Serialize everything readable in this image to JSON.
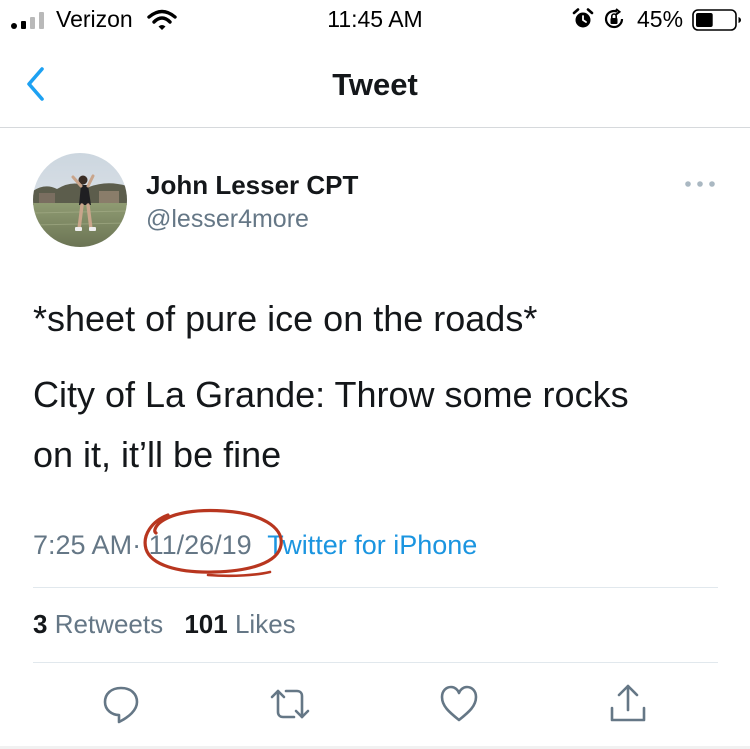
{
  "status_bar": {
    "carrier": "Verizon",
    "time": "11:45 AM",
    "battery_percent": "45%",
    "battery_level": 0.45,
    "icons": [
      "signal-icon",
      "wifi-icon",
      "alarm-icon",
      "orientation-lock-icon",
      "battery-icon"
    ]
  },
  "nav": {
    "back_icon": "chevron-left-icon",
    "title": "Tweet"
  },
  "tweet": {
    "author": {
      "display_name": "John Lesser CPT",
      "handle": "@lesser4more"
    },
    "text_lines": [
      "*sheet of pure ice on the roads*",
      "City of La Grande: Throw some rocks",
      "on it, it’ll be fine"
    ],
    "time": "7:25 AM",
    "separator": "·",
    "date": "11/26/19",
    "source": "Twitter for iPhone",
    "stats": {
      "retweets_count": "3",
      "retweets_label": "Retweets",
      "likes_count": "101",
      "likes_label": "Likes"
    },
    "actions": [
      "reply-icon",
      "retweet-icon",
      "like-icon",
      "share-icon"
    ]
  },
  "colors": {
    "accent_blue": "#1b95e0",
    "back_blue": "#1da1f2",
    "secondary_text": "#657786",
    "primary_text": "#14171a",
    "annotation_red": "#b8361f"
  }
}
